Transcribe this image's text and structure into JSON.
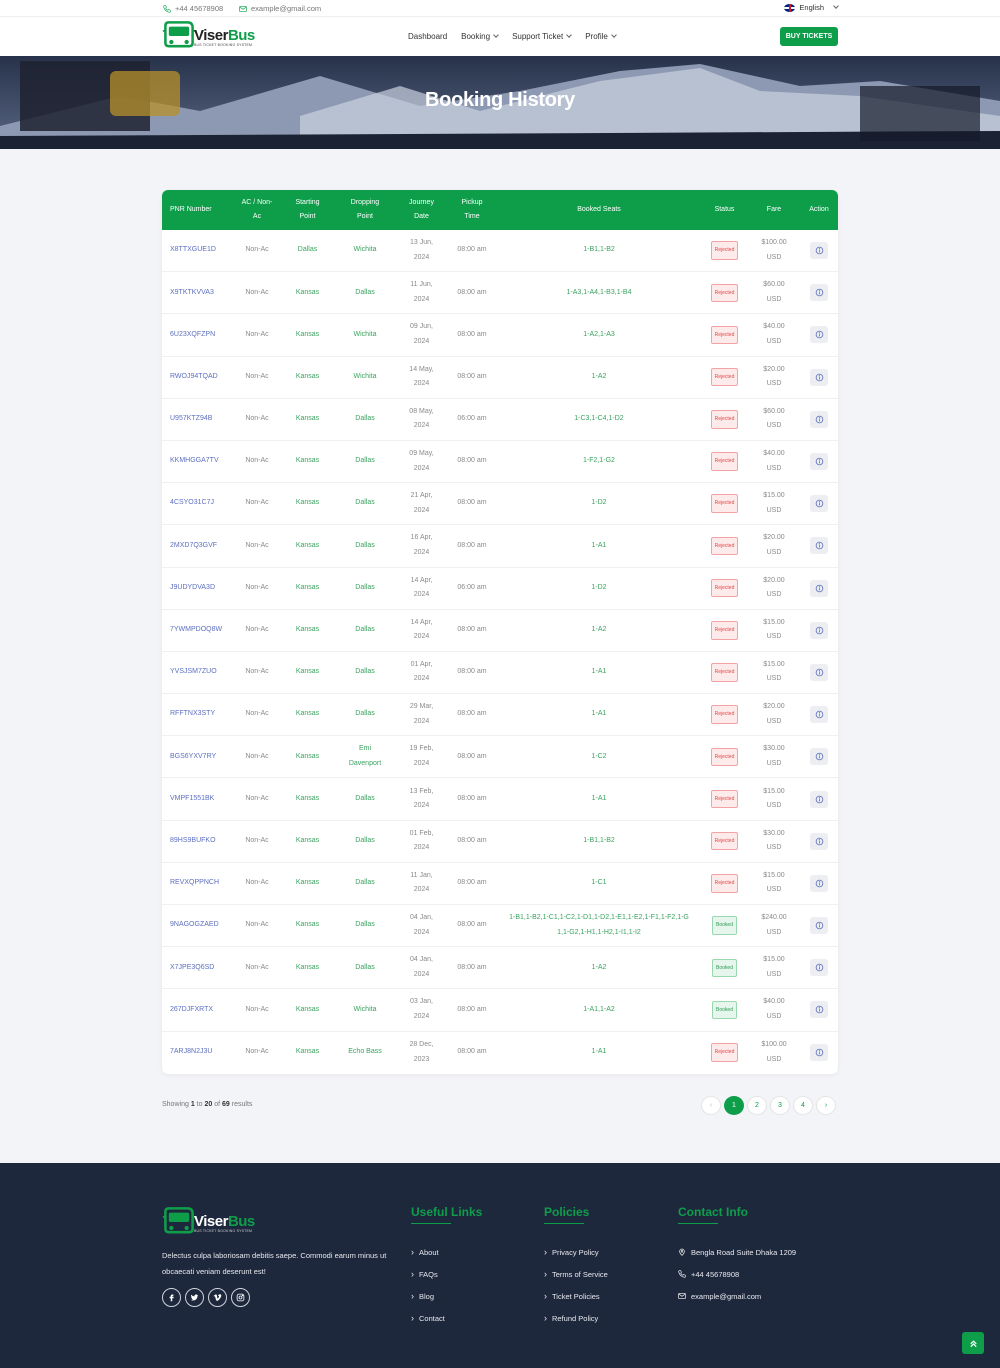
{
  "topbar": {
    "phone": "+44 45678908",
    "email": "example@gmail.com",
    "language": "English"
  },
  "brand": {
    "name_a": "Viser",
    "name_b": "Bus",
    "tagline": "BUS TICKET BOOKING SYSTEM",
    "color": "#0e9e4a"
  },
  "nav": {
    "dashboard": "Dashboard",
    "booking": "Booking",
    "support": "Support Ticket",
    "profile": "Profile",
    "buy": "BUY TICKETS"
  },
  "hero": {
    "title": "Booking History"
  },
  "table": {
    "headers": {
      "pnr": "PNR Number",
      "ac_a": "AC / Non-",
      "ac_b": "Ac",
      "start_a": "Starting",
      "start_b": "Point",
      "drop_a": "Dropping",
      "drop_b": "Point",
      "date_a": "Journey",
      "date_b": "Date",
      "pickup_a": "Pickup",
      "pickup_b": "Time",
      "seats": "Booked Seats",
      "status": "Status",
      "fare": "Fare",
      "action": "Action"
    },
    "rows": [
      {
        "pnr": "X8TTXGUE1D",
        "ac": "Non-Ac",
        "start": "Dallas",
        "drop_a": "Wichita",
        "drop_b": "",
        "date_a": "13 Jun,",
        "date_b": "2024",
        "time": "08:00 am",
        "seats_a": "1-B1,1-B2",
        "seats_b": "",
        "status": "Rejected",
        "status_type": "rejected",
        "fare": "$100.00",
        "currency": "USD"
      },
      {
        "pnr": "X9TKTKVVA3",
        "ac": "Non-Ac",
        "start": "Kansas",
        "drop_a": "Dallas",
        "drop_b": "",
        "date_a": "11 Jun,",
        "date_b": "2024",
        "time": "08:00 am",
        "seats_a": "1-A3,1-A4,1-B3,1-B4",
        "seats_b": "",
        "status": "Rejected",
        "status_type": "rejected",
        "fare": "$60.00",
        "currency": "USD"
      },
      {
        "pnr": "6U23XQFZPN",
        "ac": "Non-Ac",
        "start": "Kansas",
        "drop_a": "Wichita",
        "drop_b": "",
        "date_a": "09 Jun,",
        "date_b": "2024",
        "time": "08:00 am",
        "seats_a": "1-A2,1-A3",
        "seats_b": "",
        "status": "Rejected",
        "status_type": "rejected",
        "fare": "$40.00",
        "currency": "USD"
      },
      {
        "pnr": "RWOJ94TQAD",
        "ac": "Non-Ac",
        "start": "Kansas",
        "drop_a": "Wichita",
        "drop_b": "",
        "date_a": "14 May,",
        "date_b": "2024",
        "time": "08:00 am",
        "seats_a": "1-A2",
        "seats_b": "",
        "status": "Rejected",
        "status_type": "rejected",
        "fare": "$20.00",
        "currency": "USD"
      },
      {
        "pnr": "U957KTZ94B",
        "ac": "Non-Ac",
        "start": "Kansas",
        "drop_a": "Dallas",
        "drop_b": "",
        "date_a": "08 May,",
        "date_b": "2024",
        "time": "06:00 am",
        "seats_a": "1-C3,1-C4,1-D2",
        "seats_b": "",
        "status": "Rejected",
        "status_type": "rejected",
        "fare": "$60.00",
        "currency": "USD"
      },
      {
        "pnr": "KKMHGGA7TV",
        "ac": "Non-Ac",
        "start": "Kansas",
        "drop_a": "Dallas",
        "drop_b": "",
        "date_a": "09 May,",
        "date_b": "2024",
        "time": "08:00 am",
        "seats_a": "1-F2,1-G2",
        "seats_b": "",
        "status": "Rejected",
        "status_type": "rejected",
        "fare": "$40.00",
        "currency": "USD"
      },
      {
        "pnr": "4CSYO31C7J",
        "ac": "Non-Ac",
        "start": "Kansas",
        "drop_a": "Dallas",
        "drop_b": "",
        "date_a": "21 Apr,",
        "date_b": "2024",
        "time": "08:00 am",
        "seats_a": "1-D2",
        "seats_b": "",
        "status": "Rejected",
        "status_type": "rejected",
        "fare": "$15.00",
        "currency": "USD"
      },
      {
        "pnr": "2MXD7Q3GVF",
        "ac": "Non-Ac",
        "start": "Kansas",
        "drop_a": "Dallas",
        "drop_b": "",
        "date_a": "16 Apr,",
        "date_b": "2024",
        "time": "08:00 am",
        "seats_a": "1-A1",
        "seats_b": "",
        "status": "Rejected",
        "status_type": "rejected",
        "fare": "$20.00",
        "currency": "USD"
      },
      {
        "pnr": "J9UDYDVA3D",
        "ac": "Non-Ac",
        "start": "Kansas",
        "drop_a": "Dallas",
        "drop_b": "",
        "date_a": "14 Apr,",
        "date_b": "2024",
        "time": "06:00 am",
        "seats_a": "1-D2",
        "seats_b": "",
        "status": "Rejected",
        "status_type": "rejected",
        "fare": "$20.00",
        "currency": "USD"
      },
      {
        "pnr": "7YWMPDOQ8W",
        "ac": "Non-Ac",
        "start": "Kansas",
        "drop_a": "Dallas",
        "drop_b": "",
        "date_a": "14 Apr,",
        "date_b": "2024",
        "time": "08:00 am",
        "seats_a": "1-A2",
        "seats_b": "",
        "status": "Rejected",
        "status_type": "rejected",
        "fare": "$15.00",
        "currency": "USD"
      },
      {
        "pnr": "YVSJSM7ZUO",
        "ac": "Non-Ac",
        "start": "Kansas",
        "drop_a": "Dallas",
        "drop_b": "",
        "date_a": "01 Apr,",
        "date_b": "2024",
        "time": "08:00 am",
        "seats_a": "1-A1",
        "seats_b": "",
        "status": "Rejected",
        "status_type": "rejected",
        "fare": "$15.00",
        "currency": "USD"
      },
      {
        "pnr": "RFFTNX3STY",
        "ac": "Non-Ac",
        "start": "Kansas",
        "drop_a": "Dallas",
        "drop_b": "",
        "date_a": "29 Mar,",
        "date_b": "2024",
        "time": "08:00 am",
        "seats_a": "1-A1",
        "seats_b": "",
        "status": "Rejected",
        "status_type": "rejected",
        "fare": "$20.00",
        "currency": "USD"
      },
      {
        "pnr": "BGS6YXV7RY",
        "ac": "Non-Ac",
        "start": "Kansas",
        "drop_a": "Emi",
        "drop_b": "Davenport",
        "date_a": "19 Feb,",
        "date_b": "2024",
        "time": "08:00 am",
        "seats_a": "1-C2",
        "seats_b": "",
        "status": "Rejected",
        "status_type": "rejected",
        "fare": "$30.00",
        "currency": "USD"
      },
      {
        "pnr": "VMPF1551BK",
        "ac": "Non-Ac",
        "start": "Kansas",
        "drop_a": "Dallas",
        "drop_b": "",
        "date_a": "13 Feb,",
        "date_b": "2024",
        "time": "08:00 am",
        "seats_a": "1-A1",
        "seats_b": "",
        "status": "Rejected",
        "status_type": "rejected",
        "fare": "$15.00",
        "currency": "USD"
      },
      {
        "pnr": "89HS9BUFKO",
        "ac": "Non-Ac",
        "start": "Kansas",
        "drop_a": "Dallas",
        "drop_b": "",
        "date_a": "01 Feb,",
        "date_b": "2024",
        "time": "08:00 am",
        "seats_a": "1-B1,1-B2",
        "seats_b": "",
        "status": "Rejected",
        "status_type": "rejected",
        "fare": "$30.00",
        "currency": "USD"
      },
      {
        "pnr": "REVXQPPNCH",
        "ac": "Non-Ac",
        "start": "Kansas",
        "drop_a": "Dallas",
        "drop_b": "",
        "date_a": "11 Jan,",
        "date_b": "2024",
        "time": "08:00 am",
        "seats_a": "1-C1",
        "seats_b": "",
        "status": "Rejected",
        "status_type": "rejected",
        "fare": "$15.00",
        "currency": "USD"
      },
      {
        "pnr": "9NAGOGZAED",
        "ac": "Non-Ac",
        "start": "Kansas",
        "drop_a": "Dallas",
        "drop_b": "",
        "date_a": "04 Jan,",
        "date_b": "2024",
        "time": "08:00 am",
        "seats_a": "1-B1,1-B2,1-C1,1-C2,1-D1,1-D2,1-E1,1-E2,1-F1,1-F2,1-G",
        "seats_b": "1,1-G2,1-H1,1-H2,1-I1,1-I2",
        "status": "Booked",
        "status_type": "booked",
        "fare": "$240.00",
        "currency": "USD"
      },
      {
        "pnr": "X7JPE3Q6SD",
        "ac": "Non-Ac",
        "start": "Kansas",
        "drop_a": "Dallas",
        "drop_b": "",
        "date_a": "04 Jan,",
        "date_b": "2024",
        "time": "08:00 am",
        "seats_a": "1-A2",
        "seats_b": "",
        "status": "Booked",
        "status_type": "booked",
        "fare": "$15.00",
        "currency": "USD"
      },
      {
        "pnr": "267DJFXRTX",
        "ac": "Non-Ac",
        "start": "Kansas",
        "drop_a": "Wichita",
        "drop_b": "",
        "date_a": "03 Jan,",
        "date_b": "2024",
        "time": "08:00 am",
        "seats_a": "1-A1,1-A2",
        "seats_b": "",
        "status": "Booked",
        "status_type": "booked",
        "fare": "$40.00",
        "currency": "USD"
      },
      {
        "pnr": "7ARJ8N2J3U",
        "ac": "Non-Ac",
        "start": "Kansas",
        "drop_a": "Echo Bass",
        "drop_b": "",
        "date_a": "28 Dec,",
        "date_b": "2023",
        "time": "08:00 am",
        "seats_a": "1-A1",
        "seats_b": "",
        "status": "Rejected",
        "status_type": "rejected",
        "fare": "$100.00",
        "currency": "USD"
      }
    ]
  },
  "pagination": {
    "showing": "Showing",
    "from": "1",
    "to_word": "to",
    "to": "20",
    "of_word": "of",
    "total": "69",
    "results": "results",
    "prev": "‹",
    "next": "›",
    "pages": [
      "1",
      "2",
      "3",
      "4"
    ],
    "current": "1"
  },
  "footer": {
    "description": "Delectus culpa laboriosam debitis saepe. Commodi earum minus ut obcaecati veniam deserunt est!",
    "socials": [
      "facebook-icon",
      "twitter-icon",
      "vimeo-icon",
      "instagram-icon"
    ],
    "useful_links": {
      "title": "Useful Links",
      "items": [
        "About",
        "FAQs",
        "Blog",
        "Contact"
      ]
    },
    "policies": {
      "title": "Policies",
      "items": [
        "Privacy Policy",
        "Terms of Service",
        "Ticket Policies",
        "Refund Policy"
      ]
    },
    "contact": {
      "title": "Contact Info",
      "address": "Bengla Road Suite Dhaka 1209",
      "phone": "+44 45678908",
      "email": "example@gmail.com"
    }
  }
}
